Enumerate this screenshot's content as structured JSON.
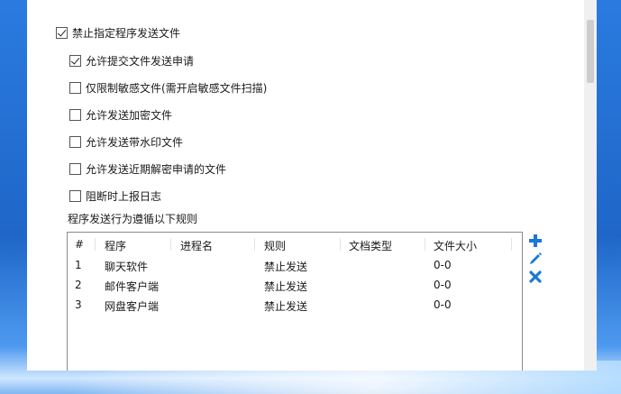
{
  "options": [
    {
      "label": "禁止指定程序发送文件",
      "checked": true
    },
    {
      "label": "允许提交文件发送申请",
      "checked": true
    },
    {
      "label": "仅限制敏感文件(需开启敏感文件扫描)",
      "checked": false
    },
    {
      "label": "允许发送加密文件",
      "checked": false
    },
    {
      "label": "允许发送带水印文件",
      "checked": false
    },
    {
      "label": "允许发送近期解密申请的文件",
      "checked": false
    },
    {
      "label": "阻断时上报日志",
      "checked": false
    }
  ],
  "rules_section_label": "程序发送行为遵循以下规则",
  "table": {
    "headers": [
      "#",
      "程序",
      "进程名",
      "规则",
      "文档类型",
      "文件大小"
    ],
    "rows": [
      {
        "index": "1",
        "program": "聊天软件",
        "process": "",
        "rule": "禁止发送",
        "doctype": "",
        "size": "0-0"
      },
      {
        "index": "2",
        "program": "邮件客户端",
        "process": "",
        "rule": "禁止发送",
        "doctype": "",
        "size": "0-0"
      },
      {
        "index": "3",
        "program": "网盘客户端",
        "process": "",
        "rule": "禁止发送",
        "doctype": "",
        "size": "0-0"
      }
    ]
  },
  "actions": [
    {
      "icon": "plus-icon",
      "label": "add"
    },
    {
      "icon": "pencil-icon",
      "label": "edit"
    },
    {
      "icon": "close-icon",
      "label": "delete"
    }
  ],
  "colors": {
    "accent": "#1a78d6",
    "wallpaper": "#1f66c8"
  }
}
